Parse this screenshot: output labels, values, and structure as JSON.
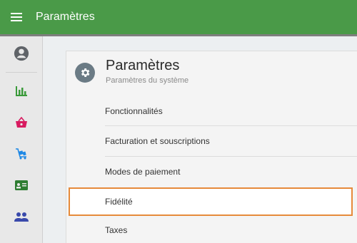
{
  "topbar": {
    "title": "Paramètres",
    "menu_icon": "hamburger-menu-icon"
  },
  "sidebar": {
    "items": [
      {
        "name": "account-icon",
        "color": "#5f6368"
      },
      {
        "name": "bar-chart-icon",
        "color": "#3a9a3a"
      },
      {
        "name": "shopping-basket-icon",
        "color": "#d81b60"
      },
      {
        "name": "delivery-cart-icon",
        "color": "#1e88e5"
      },
      {
        "name": "id-card-icon",
        "color": "#2e7d32"
      },
      {
        "name": "people-icon",
        "color": "#3949ab"
      }
    ]
  },
  "panel": {
    "title": "Paramètres",
    "subtitle": "Paramètres du système",
    "icon": "gear-icon",
    "items": [
      {
        "label": "Fonctionnalités"
      },
      {
        "label": "Facturation et souscriptions"
      },
      {
        "label": "Modes de paiement"
      },
      {
        "label": "Fidélité",
        "highlighted": true
      },
      {
        "label": "Taxes"
      }
    ]
  },
  "colors": {
    "topbar": "#4a9a48",
    "highlight_border": "#e68a3a"
  }
}
